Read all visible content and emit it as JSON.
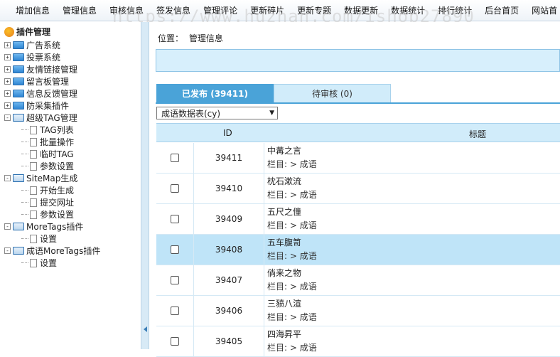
{
  "nav": [
    "增加信息",
    "管理信息",
    "审核信息",
    "签发信息",
    "管理评论",
    "更新碎片",
    "更新专题",
    "数据更新",
    "数据统计",
    "排行统计",
    "后台首页",
    "网站首"
  ],
  "watermark": "https://www.huzhan.com/ishop27890",
  "sidebar": {
    "title": "插件管理",
    "tree": [
      {
        "label": "广告系统",
        "type": "folder",
        "sign": "+"
      },
      {
        "label": "投票系统",
        "type": "folder",
        "sign": "+"
      },
      {
        "label": "友情链接管理",
        "type": "folder",
        "sign": "+"
      },
      {
        "label": "留言板管理",
        "type": "folder",
        "sign": "+"
      },
      {
        "label": "信息反馈管理",
        "type": "folder",
        "sign": "+"
      },
      {
        "label": "防采集插件",
        "type": "folder",
        "sign": "+"
      },
      {
        "label": "超级TAG管理",
        "type": "grid",
        "sign": "-"
      },
      {
        "label": "TAG列表",
        "type": "doc"
      },
      {
        "label": "批量操作",
        "type": "doc"
      },
      {
        "label": "临时TAG",
        "type": "doc"
      },
      {
        "label": "参数设置",
        "type": "doc"
      },
      {
        "label": "SiteMap生成",
        "type": "grid",
        "sign": "-"
      },
      {
        "label": "开始生成",
        "type": "doc"
      },
      {
        "label": "提交网址",
        "type": "doc"
      },
      {
        "label": "参数设置",
        "type": "doc"
      },
      {
        "label": "MoreTags插件",
        "type": "grid",
        "sign": "-"
      },
      {
        "label": "设置",
        "type": "doc"
      },
      {
        "label": "成语MoreTags插件",
        "type": "grid",
        "sign": "-"
      },
      {
        "label": "设置",
        "type": "doc"
      }
    ]
  },
  "breadcrumb": {
    "prefix": "位置：",
    "link": "管理信息"
  },
  "tabs": [
    {
      "label": "已发布 (39411)",
      "active": true
    },
    {
      "label": "待审核 (0)",
      "active": false
    }
  ],
  "filter": {
    "selected": "成语数据表(cy)"
  },
  "table": {
    "headers": {
      "id": "ID",
      "title": "标题"
    },
    "rows": [
      {
        "id": "39411",
        "title": "中冓之言",
        "category": "栏目: > 成语",
        "highlight": false
      },
      {
        "id": "39410",
        "title": "枕石漱流",
        "category": "栏目: > 成语",
        "highlight": false
      },
      {
        "id": "39409",
        "title": "五尺之僮",
        "category": "栏目: > 成语",
        "highlight": false
      },
      {
        "id": "39408",
        "title": "五车腹笥",
        "category": "栏目: > 成语",
        "highlight": true
      },
      {
        "id": "39407",
        "title": "倘来之物",
        "category": "栏目: > 成语",
        "highlight": false
      },
      {
        "id": "39406",
        "title": "三豮八渲",
        "category": "栏目: > 成语",
        "highlight": false
      },
      {
        "id": "39405",
        "title": "四海昇平",
        "category": "栏目: > 成语",
        "highlight": false
      }
    ]
  },
  "colors": {
    "accent": "#4aa3d8",
    "light": "#d1ecfa",
    "highlight_row": "#bfe4f8"
  }
}
